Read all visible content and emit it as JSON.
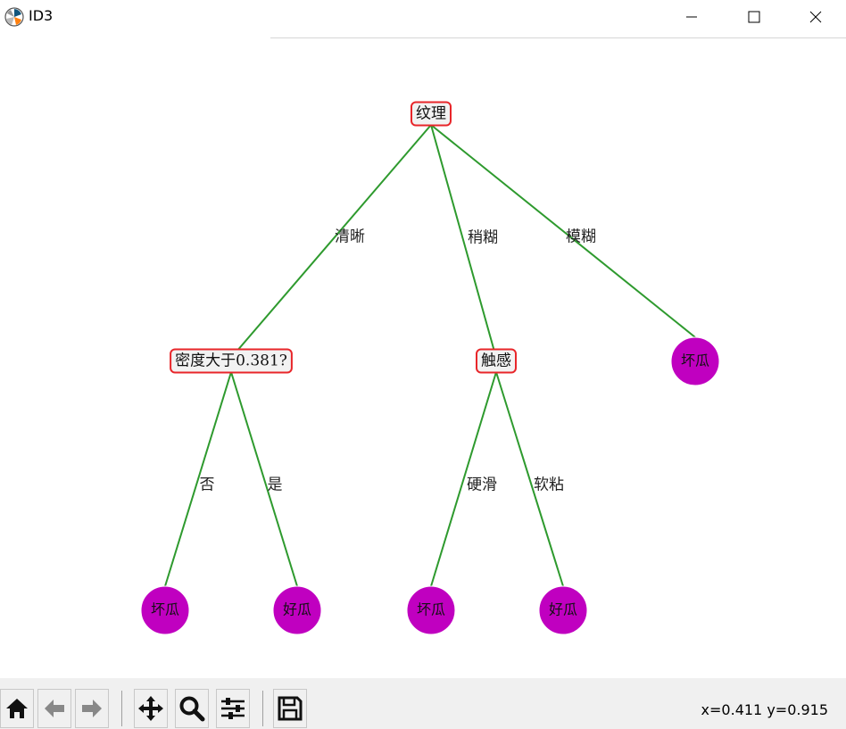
{
  "window": {
    "title": "ID3",
    "icon": "matplotlib-icon",
    "controls": [
      "minimize-icon",
      "maximize-icon",
      "close-icon"
    ]
  },
  "tree": {
    "nodes": [
      {
        "id": "root",
        "label": "纹理",
        "kind": "decision"
      },
      {
        "id": "n-density",
        "label": "密度大于0.381?",
        "kind": "decision"
      },
      {
        "id": "n-touch",
        "label": "触感",
        "kind": "decision"
      },
      {
        "id": "leaf-1",
        "label": "坏瓜",
        "kind": "leaf"
      },
      {
        "id": "leaf-2",
        "label": "坏瓜",
        "kind": "leaf"
      },
      {
        "id": "leaf-3",
        "label": "好瓜",
        "kind": "leaf"
      },
      {
        "id": "leaf-4",
        "label": "坏瓜",
        "kind": "leaf"
      },
      {
        "id": "leaf-5",
        "label": "好瓜",
        "kind": "leaf"
      }
    ],
    "edges": [
      {
        "from": "root",
        "to": "n-density",
        "label": "清晰"
      },
      {
        "from": "root",
        "to": "n-touch",
        "label": "稍糊"
      },
      {
        "from": "root",
        "to": "leaf-1",
        "label": "模糊"
      },
      {
        "from": "n-density",
        "to": "leaf-2",
        "label": "否"
      },
      {
        "from": "n-density",
        "to": "leaf-3",
        "label": "是"
      },
      {
        "from": "n-touch",
        "to": "leaf-4",
        "label": "硬滑"
      },
      {
        "from": "n-touch",
        "to": "leaf-5",
        "label": "软粘"
      }
    ],
    "colors": {
      "decision_border": "#e8262a",
      "decision_fill": "#f2f2f2",
      "leaf_fill": "#c000c0",
      "edge": "#2e9a2e"
    }
  },
  "toolbar": {
    "buttons": [
      "home-icon",
      "back-icon",
      "forward-icon",
      "pan-icon",
      "zoom-icon",
      "configure-subplots-icon",
      "save-icon"
    ],
    "coords": "x=0.411 y=0.915"
  }
}
